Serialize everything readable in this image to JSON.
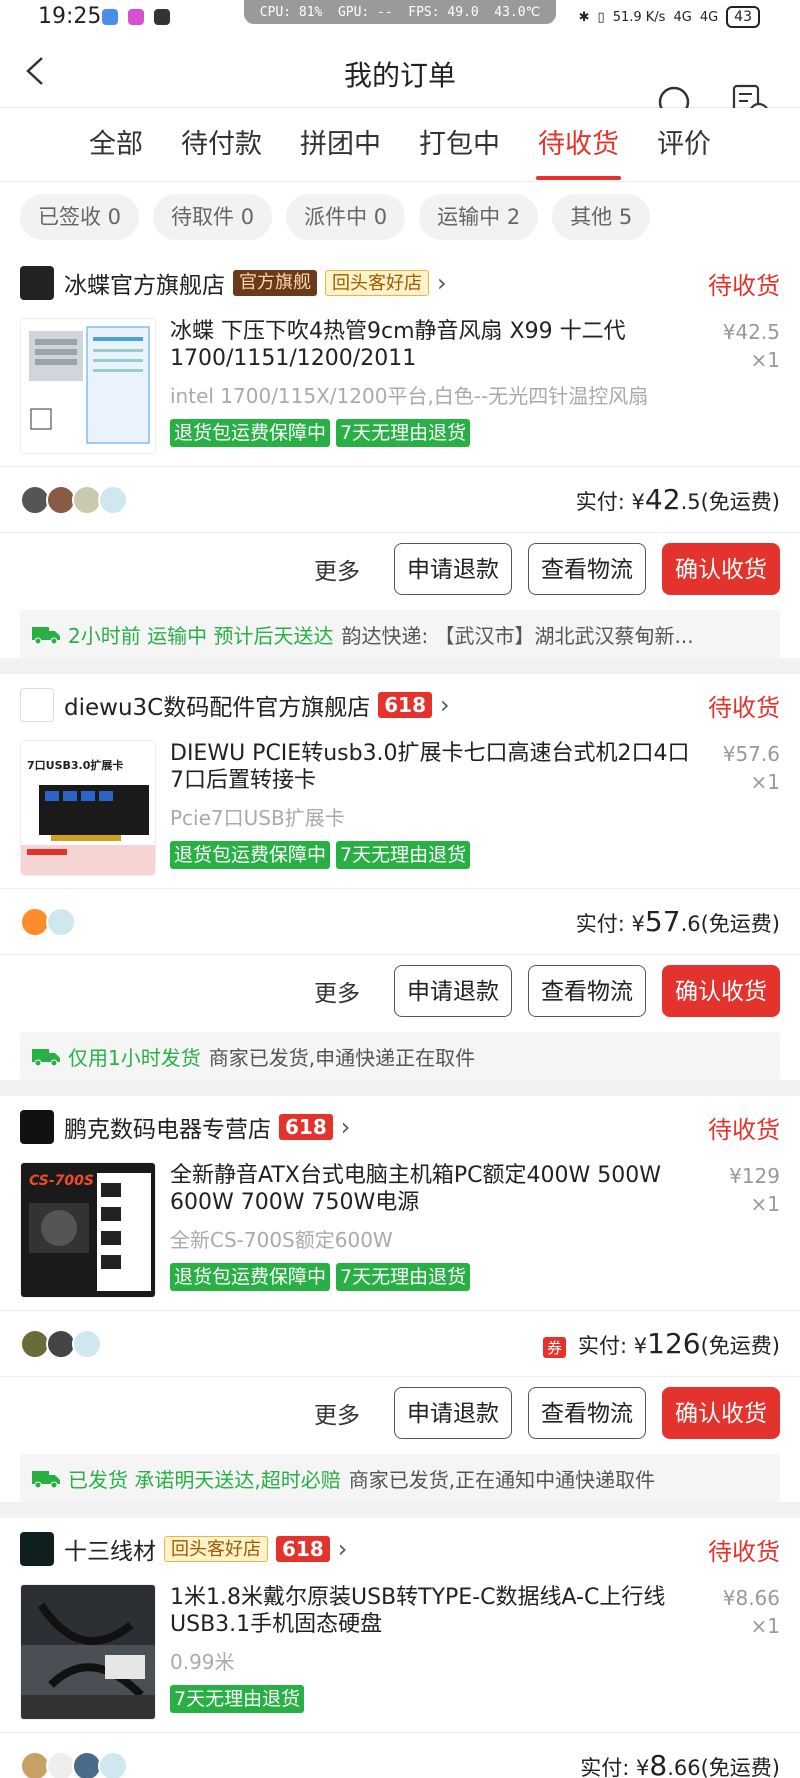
{
  "status_bar": {
    "time": "19:25",
    "cpu": "CPU: 81%",
    "gpu": "GPU: --",
    "fps": "FPS: 49.0",
    "temp": "43.0℃",
    "net": "51.9 K/s",
    "sig1": "4G",
    "sig2": "4G",
    "battery": "43"
  },
  "nav": {
    "title": "我的订单"
  },
  "tabs": [
    "全部",
    "待付款",
    "拼团中",
    "打包中",
    "待收货",
    "评价"
  ],
  "active_tab": "待收货",
  "chips": [
    "已签收 0",
    "待取件 0",
    "派件中 0",
    "运输中 2",
    "其他 5"
  ],
  "colors": {
    "accent": "#e4322c",
    "green": "#28b044"
  },
  "orders": [
    {
      "shop": "冰蝶官方旗舰店",
      "tag_official": "官方旗舰",
      "tag_repeat": "回头客好店",
      "status": "待收货",
      "product": "冰蝶 下压下吹4热管9cm静音风扇 X99 十二代1700/1151/1200/2011",
      "spec": "intel 1700/115X/1200平台,白色--无光四针温控风扇",
      "badges": [
        "退货包运费保障中",
        "7天无理由退货"
      ],
      "price_int": "¥42",
      "price_dec": ".5",
      "qty": "×1",
      "paid_label": "实付: ",
      "paid_sym": "¥",
      "paid_int": "42",
      "paid_dec": ".5",
      "paid_note": "(免运费)",
      "buttons": [
        "更多",
        "申请退款",
        "查看物流",
        "确认收货"
      ],
      "ship_green": "2小时前 运输中 预计后天送达",
      "ship_text": "韵达快递: 【武汉市】湖北武汉蔡甸新..."
    },
    {
      "shop": "diewu3C数码配件官方旗舰店",
      "tag_618": "618",
      "status": "待收货",
      "product": "DIEWU PCIE转usb3.0扩展卡七口高速台式机2口4口7口后置转接卡",
      "spec": "Pcie7口USB扩展卡",
      "badges": [
        "退货包运费保障中",
        "7天无理由退货"
      ],
      "price_int": "¥57",
      "price_dec": ".6",
      "qty": "×1",
      "paid_label": "实付: ",
      "paid_sym": "¥",
      "paid_int": "57",
      "paid_dec": ".6",
      "paid_note": "(免运费)",
      "buttons": [
        "更多",
        "申请退款",
        "查看物流",
        "确认收货"
      ],
      "ship_green": "仅用1小时发货",
      "ship_text": "商家已发货,申通快递正在取件",
      "thumb_label": "7口USB3.0扩展卡"
    },
    {
      "shop": "鹏克数码电器专营店",
      "tag_618": "618",
      "status": "待收货",
      "product": "全新静音ATX台式电脑主机箱PC额定400W 500W 600W 700W 750W电源",
      "spec": "全新CS-700S额定600W",
      "badges": [
        "退货包运费保障中",
        "7天无理由退货"
      ],
      "price_int": "¥129",
      "price_dec": "",
      "qty": "×1",
      "paid_label": "实付: ",
      "paid_sym": "¥",
      "paid_int": "126",
      "paid_dec": "",
      "paid_note": "(免运费)",
      "coupon": "券",
      "buttons": [
        "更多",
        "申请退款",
        "查看物流",
        "确认收货"
      ],
      "ship_green": "已发货 承诺明天送达,超时必赔",
      "ship_text": "商家已发货,正在通知中通快递取件",
      "thumb_label": "CS-700S"
    },
    {
      "shop": "十三线材",
      "tag_repeat": "回头客好店",
      "tag_618": "618",
      "status": "待收货",
      "product": "1米1.8米戴尔原装USB转TYPE-C数据线A-C上行线USB3.1手机固态硬盘",
      "spec": "0.99米",
      "badges": [
        "7天无理由退货"
      ],
      "price_int": "¥8",
      "price_dec": ".66",
      "qty": "×1",
      "paid_label": "实付: ",
      "paid_sym": "¥",
      "paid_int": "8",
      "paid_dec": ".66",
      "paid_note": "(免运费)"
    }
  ]
}
